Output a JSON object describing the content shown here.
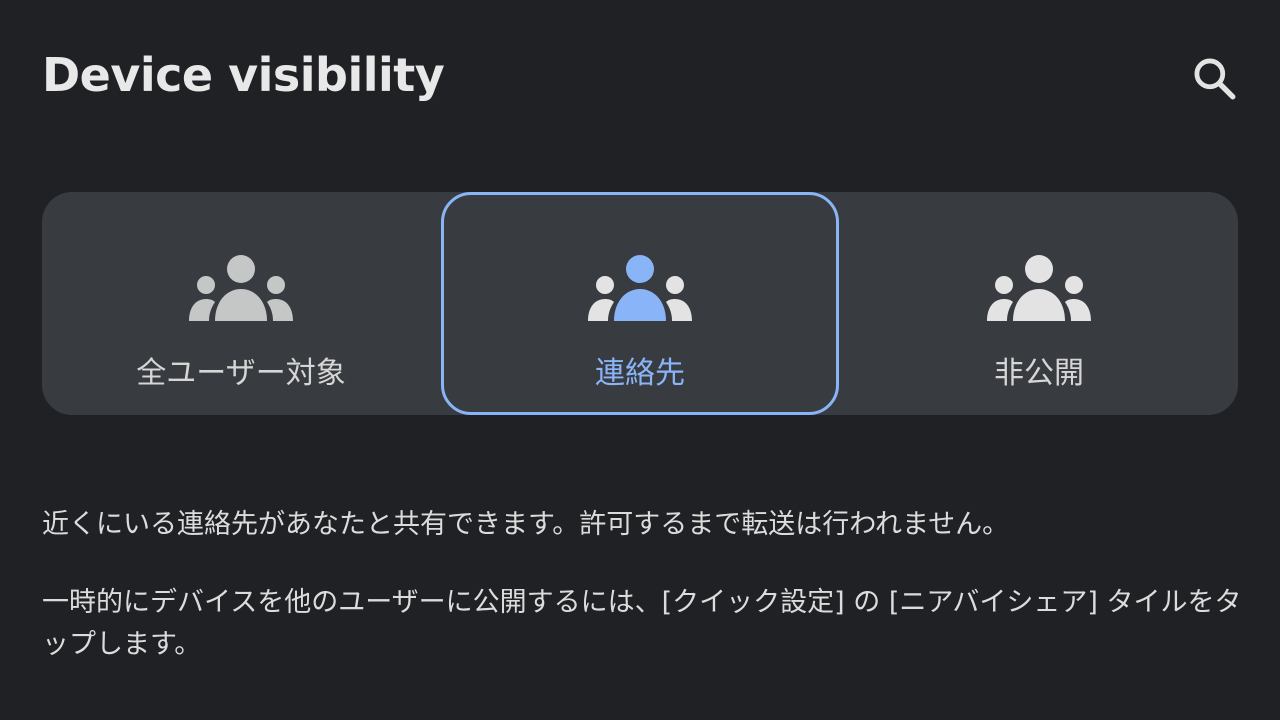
{
  "header": {
    "title": "Device visibility",
    "search_icon": "search-icon"
  },
  "visibility_options": [
    {
      "label": "全ユーザー対象",
      "icon": "people-icon",
      "selected": false
    },
    {
      "label": "連絡先",
      "icon": "people-icon",
      "selected": true
    },
    {
      "label": "非公開",
      "icon": "people-icon",
      "selected": false
    }
  ],
  "description": {
    "line1": "近くにいる連絡先があなたと共有できます。許可するまで転送は行われません。",
    "line2": "一時的にデバイスを他のユーザーに公開するには、[クイック設定] の [ニアバイシェア] タイルをタップします。"
  },
  "colors": {
    "background": "#1f2124",
    "card": "#383b40",
    "accent": "#8ab4f8",
    "text": "#e3e3e3",
    "icon_inactive_all": "#c4c7c5",
    "icon_inactive_hidden": "#e3e3e3"
  }
}
